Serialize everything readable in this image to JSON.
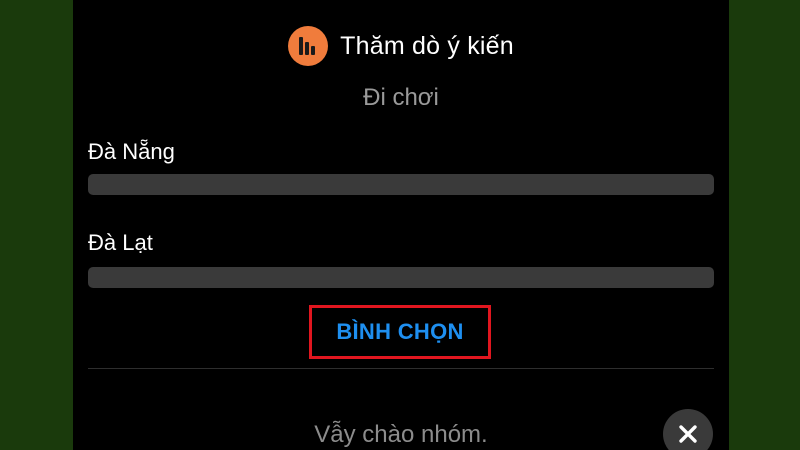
{
  "poll": {
    "header_title": "Thăm dò ý kiến",
    "question": "Đi chơi",
    "options": [
      {
        "label": "Đà Nẵng",
        "vote_fraction": 0
      },
      {
        "label": "Đà Lạt",
        "vote_fraction": 0
      }
    ],
    "vote_button_label": "BÌNH CHỌN"
  },
  "footer": {
    "wave_text": "Vẫy chào nhóm."
  },
  "icons": {
    "poll": "poll-chart-icon",
    "close": "close-icon"
  },
  "colors": {
    "poll_icon_bg": "#f07c3c",
    "vote_button_text": "#1e8ff0",
    "highlight_box": "#e0161f",
    "progress_track": "#3a3a3a",
    "background_outer": "#1b3a0e",
    "panel_background": "#000000"
  }
}
